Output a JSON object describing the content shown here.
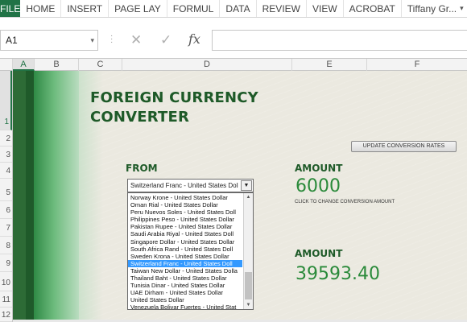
{
  "ribbon": {
    "tabs": [
      "FILE",
      "HOME",
      "INSERT",
      "PAGE LAY",
      "FORMUL",
      "DATA",
      "REVIEW",
      "VIEW",
      "ACROBAT"
    ],
    "user": "Tiffany Gr..."
  },
  "formula_bar": {
    "name_box": "A1",
    "fx_label": "fx",
    "cancel_icon": "close-icon",
    "enter_icon": "checkmark-icon",
    "value": ""
  },
  "columns": [
    "A",
    "B",
    "C",
    "D",
    "E",
    "F"
  ],
  "rows": [
    "1",
    "2",
    "3",
    "4",
    "5",
    "6",
    "7",
    "8",
    "9",
    "10",
    "11",
    "12"
  ],
  "sheet": {
    "title_line1": "FOREIGN CURRENCY",
    "title_line2": "CONVERTER",
    "update_button": "UPDATE CONVERSION RATES",
    "from_label": "FROM",
    "amount_label_1": "AMOUNT",
    "amount_value_1": "6000",
    "amount_hint": "CLICK TO CHANGE CONVERSION AMOUNT",
    "amount_label_2": "AMOUNT",
    "amount_value_2": "39593.40",
    "combo_value": "Switzerland Franc - United States Doll",
    "dropdown_items": [
      "Norway Krone - United States Dollar",
      "Oman Rial - United States Dollar",
      "Peru Nuevos Soles - United States Doll",
      "Philippines Peso - United States Dollar",
      "Pakistan Rupee - United States Dollar",
      "Saudi Arabia Riyal - United States Doll",
      "Singapore Dollar - United States Dollar",
      "South Africa Rand - United States Doll",
      "Sweden Krona - United States Dollar",
      "Switzerland Franc - United States Doll",
      "Taiwan New Dollar - United States Dolla",
      "Thailand Baht - United States Dollar",
      "Tunisia Dinar - United States Dollar",
      "UAE Dirham - United States Dollar",
      "United States Dollar",
      "Venezuela Bolivar Fuertes - United Stat"
    ],
    "selected_index": 9
  },
  "colors": {
    "excel_green": "#217346",
    "title_green": "#1e5a28",
    "value_green": "#2a8a3a",
    "selection_blue": "#3399ff"
  }
}
